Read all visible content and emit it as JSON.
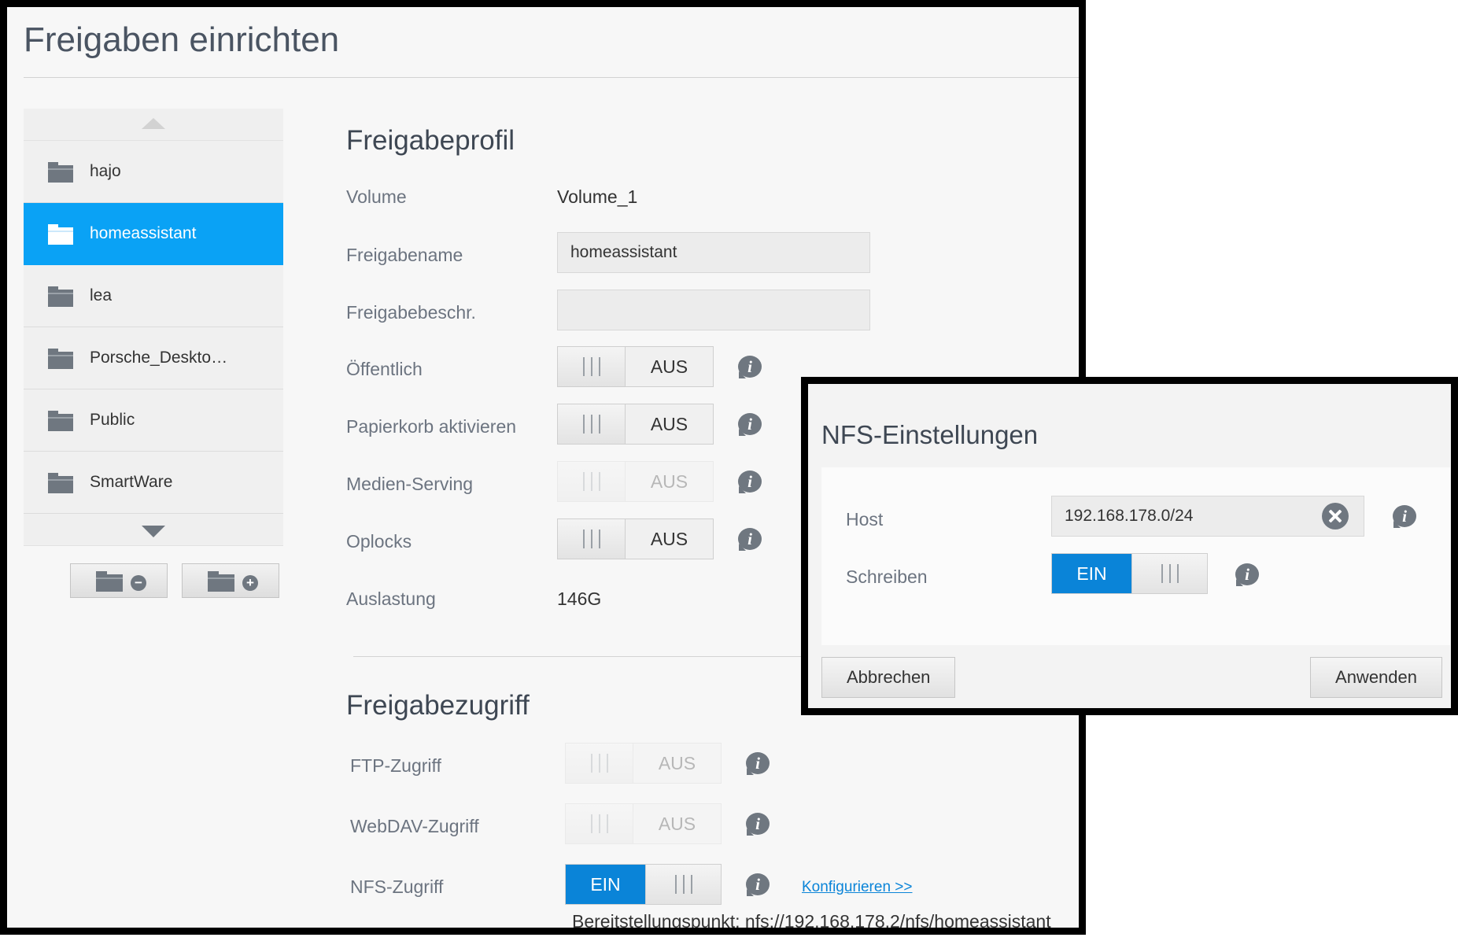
{
  "page": {
    "title": "Freigaben einrichten"
  },
  "shares": {
    "items": [
      {
        "label": "hajo",
        "active": false
      },
      {
        "label": "homeassistant",
        "active": true
      },
      {
        "label": "lea",
        "active": false
      },
      {
        "label": "Porsche_Deskto…",
        "active": false
      },
      {
        "label": "Public",
        "active": false
      },
      {
        "label": "SmartWare",
        "active": false
      }
    ],
    "remove_icon": "folder-minus-icon",
    "add_icon": "folder-plus-icon"
  },
  "profile": {
    "title": "Freigabeprofil",
    "volume_label": "Volume",
    "volume_value": "Volume_1",
    "name_label": "Freigabename",
    "name_value": "homeassistant",
    "desc_label": "Freigabebeschr.",
    "desc_value": "",
    "public_label": "Öffentlich",
    "public_state": "AUS",
    "trash_label": "Papierkorb aktivieren",
    "trash_state": "AUS",
    "media_label": "Medien-Serving",
    "media_state": "AUS",
    "oplocks_label": "Oplocks",
    "oplocks_state": "AUS",
    "usage_label": "Auslastung",
    "usage_value": "146G"
  },
  "access": {
    "title": "Freigabezugriff",
    "ftp_label": "FTP-Zugriff",
    "ftp_state": "AUS",
    "webdav_label": "WebDAV-Zugriff",
    "webdav_state": "AUS",
    "nfs_label": "NFS-Zugriff",
    "nfs_state": "EIN",
    "configure_link": "Konfigurieren >>",
    "mount_point": "Bereitstellungspunkt: nfs://192.168.178.2/nfs/homeassistant"
  },
  "nfs_dialog": {
    "title": "NFS-Einstellungen",
    "host_label": "Host",
    "host_value": "192.168.178.0/24",
    "write_label": "Schreiben",
    "write_state": "EIN",
    "cancel_label": "Abbrechen",
    "apply_label": "Anwenden"
  },
  "colors": {
    "accent": "#0aa2f5",
    "toggle_on": "#0a84d8",
    "icon_gray": "#6f7780",
    "heading": "#3e4753"
  }
}
